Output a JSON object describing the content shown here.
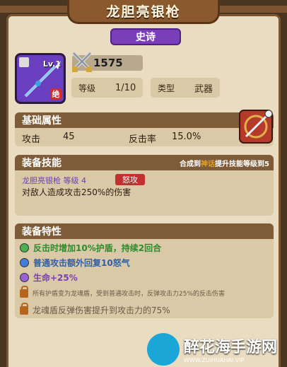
{
  "title": "龙胆亮银枪",
  "rarity": "史诗",
  "weapon": {
    "level_label": "Lv.1",
    "grade_badge": "绝",
    "power": "1575"
  },
  "info": {
    "level_label": "等级",
    "level_value": "1/10",
    "type_label": "类型",
    "type_value": "武器"
  },
  "base_stats": {
    "header": "基础属性",
    "attack_label": "攻击",
    "attack_value": "45",
    "counter_label": "反击率",
    "counter_value": "15.0%"
  },
  "skill": {
    "header": "装备技能",
    "upgrade_hint_prefix": "合成到",
    "upgrade_hint_highlight": "神话",
    "upgrade_hint_suffix": "提升技能等级到5",
    "name_line": "龙胆亮银枪 等级 4",
    "tag": "怒攻",
    "desc": "对敌人造成攻击250%的伤害"
  },
  "traits": {
    "header": "装备特性",
    "items": [
      {
        "text": "反击时增加10%护盾，持续2回合",
        "color": "#2e8b2e",
        "dot": "#4caf50",
        "locked": false
      },
      {
        "text": "普通攻击额外回复10怒气",
        "color": "#2f5fa8",
        "dot": "#3d7fd9",
        "locked": false
      },
      {
        "text": "生命+25%",
        "color": "#7b3fb8",
        "dot": "#9b5fd9",
        "locked": false
      },
      {
        "text": "所有护盾变为龙魂盾，受到普通攻击时，反弹攻击力25%的反击伤害",
        "color": "#6a5a48",
        "dot": "",
        "locked": true
      },
      {
        "text": "龙魂盾反弹伤害提升到攻击力的75%",
        "color": "#6a5a48",
        "dot": "",
        "locked": true
      }
    ]
  },
  "watermark": {
    "name": "醉花海手游网",
    "url": "WWW.ZUIHUAHAI.VIP"
  },
  "colors": {
    "frame": "#4a3520",
    "panel": "#e9dcc0",
    "section_header": "#7e5c3a",
    "rarity": "#7a3fb8",
    "skill_tag": "#c23030"
  }
}
